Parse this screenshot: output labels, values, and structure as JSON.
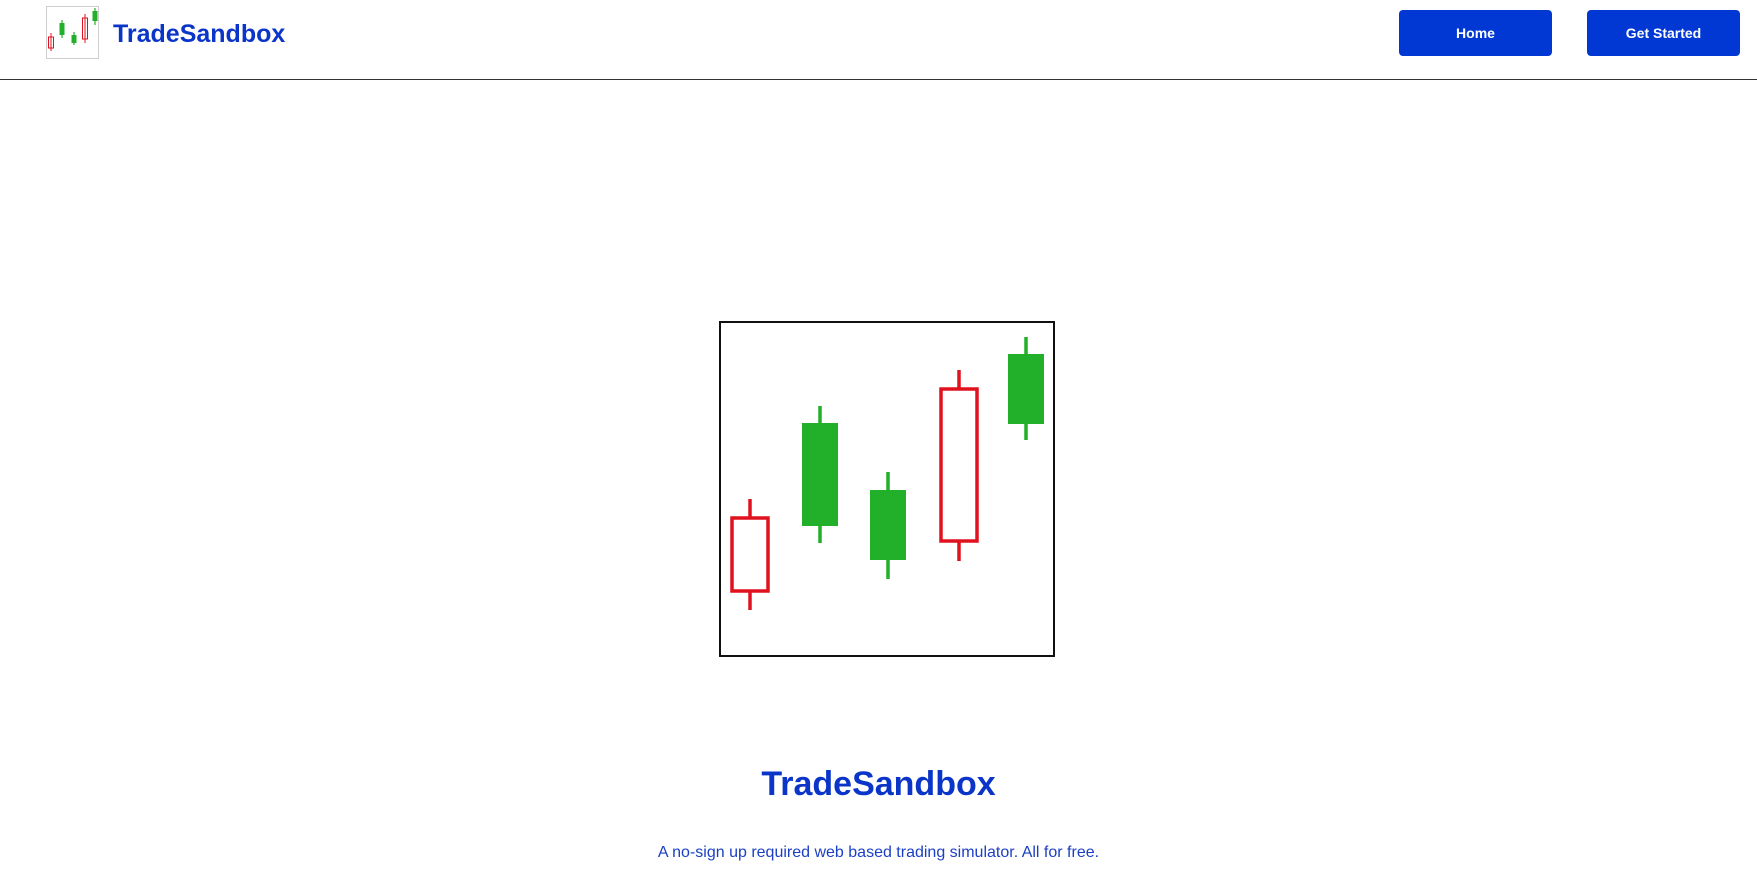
{
  "header": {
    "brand_name": "TradeSandbox",
    "logo_icon": "candlestick-chart-icon",
    "nav": {
      "home_label": "Home",
      "get_started_label": "Get Started"
    }
  },
  "hero": {
    "illustration_icon": "candlestick-chart-icon",
    "title": "TradeSandbox",
    "subtitle": "A no-sign up required web based trading simulator. All for free."
  },
  "colors": {
    "brand_blue": "#0a35c8",
    "button_blue": "#0138d4",
    "bull_green": "#22b02a",
    "bear_red": "#e0121f"
  }
}
